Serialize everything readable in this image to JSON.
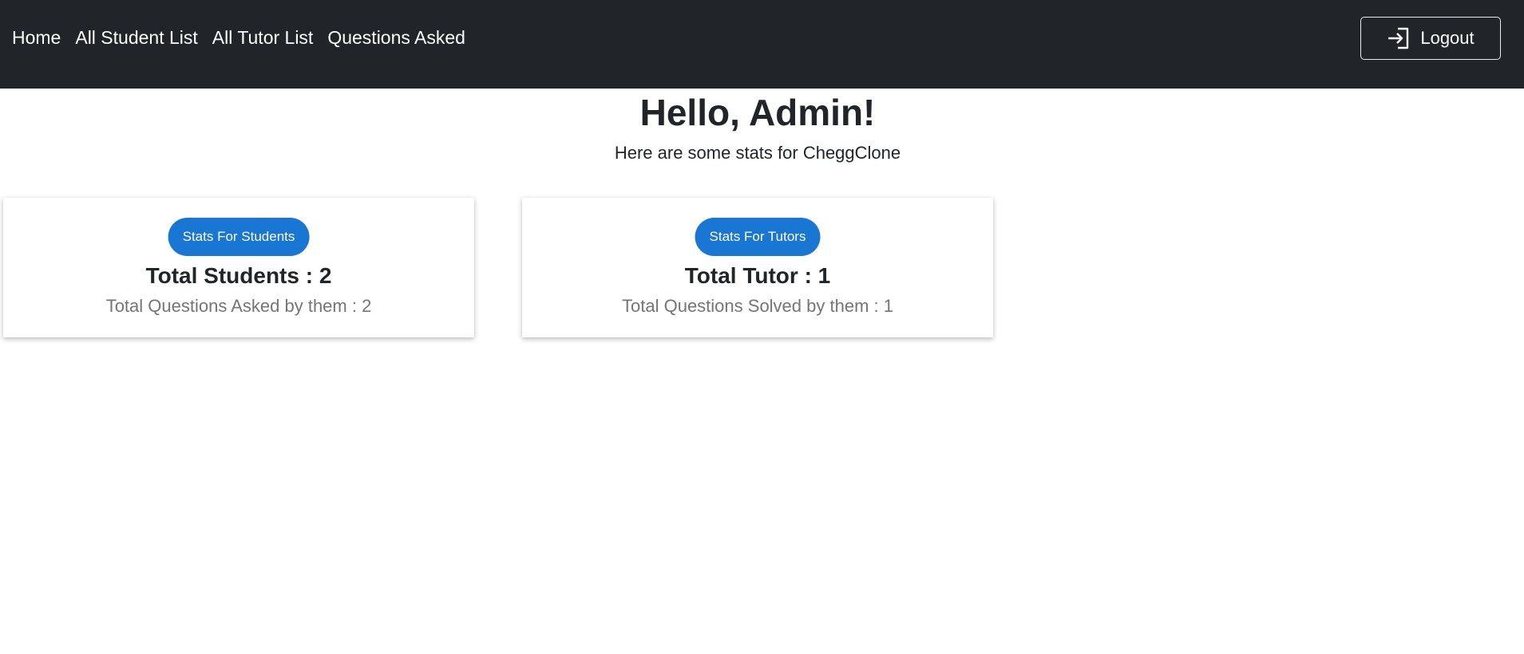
{
  "nav": {
    "links": [
      "Home",
      "All Student List",
      "All Tutor List",
      "Questions Asked"
    ],
    "logout_label": "Logout",
    "background_color": "#212529"
  },
  "header": {
    "greeting": "Hello, Admin!",
    "subtitle": "Here are some stats for CheggClone"
  },
  "cards": {
    "students": {
      "button_label": "Stats For Students",
      "title": "Total Students : 2",
      "subtitle": "Total Questions Asked by them : 2"
    },
    "tutors": {
      "button_label": "Stats For Tutors",
      "title": "Total Tutor : 1",
      "subtitle": "Total Questions Solved by them : 1"
    }
  },
  "colors": {
    "accent": "#1976d2",
    "muted_text": "#757575"
  },
  "icons": {
    "logout": "login-arrow-icon"
  }
}
